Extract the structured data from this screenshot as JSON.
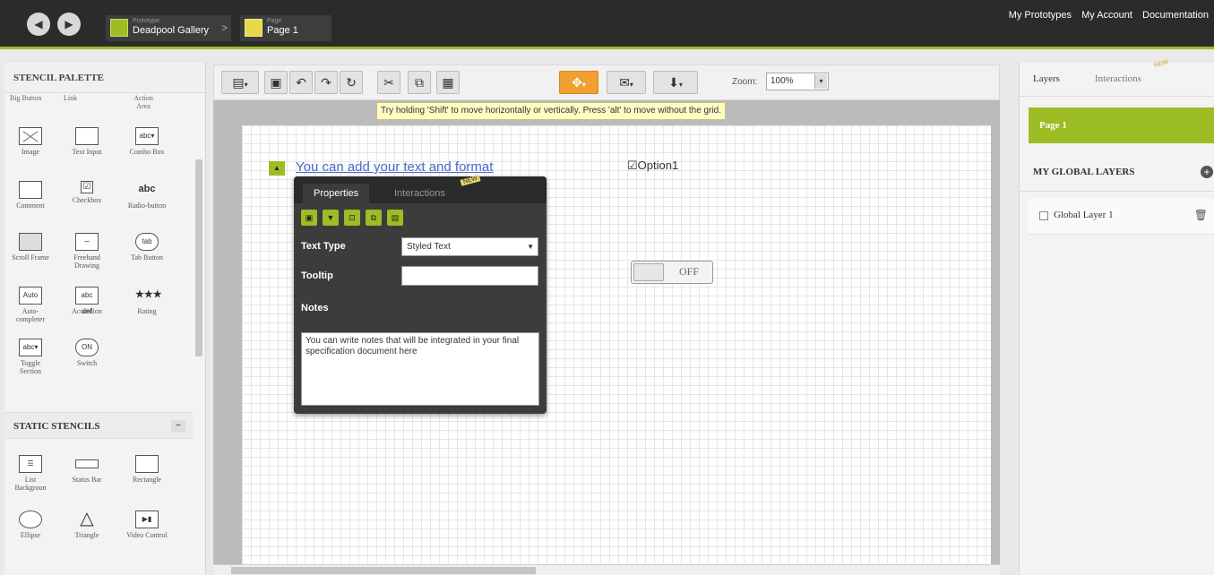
{
  "topbar": {
    "prototype_caption": "Prototype",
    "prototype_name": "Deadpool Gallery",
    "page_caption": "Page",
    "page_name": "Page 1",
    "links": [
      "My Prototypes",
      "My Account",
      "Documentation"
    ]
  },
  "palette": {
    "title": "STENCIL PALETTE",
    "top_labels": [
      "Big Button",
      "Link",
      "Action Area"
    ],
    "items": [
      {
        "label": "Image",
        "icon": "image-icon"
      },
      {
        "label": "Text Input",
        "icon": "text-input-icon"
      },
      {
        "label": "Combo Box",
        "icon": "combo-box-icon",
        "glyph": "abc▾"
      },
      {
        "label": "Comment",
        "icon": "comment-icon"
      },
      {
        "label": "Checkbox",
        "icon": "checkbox-icon",
        "glyph": "☑"
      },
      {
        "label": "Radio-button",
        "icon": "radio-button-icon",
        "glyph": "abc"
      },
      {
        "label": "Scroll Frame",
        "icon": "scroll-frame-icon"
      },
      {
        "label": "Freehand Drawing",
        "icon": "freehand-drawing-icon"
      },
      {
        "label": "Tab Button",
        "icon": "tab-button-icon",
        "glyph": "tab"
      },
      {
        "label": "Auto-completer",
        "icon": "auto-completer-icon",
        "glyph": "Auto"
      },
      {
        "label": "Accordion",
        "icon": "accordion-icon",
        "glyph": "abc def"
      },
      {
        "label": "Rating",
        "icon": "rating-icon",
        "glyph": "★★★"
      },
      {
        "label": "Toggle Section",
        "icon": "toggle-section-icon",
        "glyph": "abc▾"
      },
      {
        "label": "Switch",
        "icon": "switch-icon",
        "glyph": "ON"
      }
    ],
    "static_title": "STATIC STENCILS",
    "static_items": [
      {
        "label": "List Backgroun",
        "icon": "list-background-icon"
      },
      {
        "label": "Status Bar",
        "icon": "status-bar-icon"
      },
      {
        "label": "Rectangle",
        "icon": "rectangle-icon"
      },
      {
        "label": "Ellipse",
        "icon": "ellipse-icon"
      },
      {
        "label": "Triangle",
        "icon": "triangle-icon"
      },
      {
        "label": "Video Control",
        "icon": "video-control-icon"
      }
    ]
  },
  "toolbar": {
    "zoom_label": "Zoom:",
    "zoom_value": "100%"
  },
  "tooltip": "Try holding 'Shift' to move horizontally or vertically. Press 'alt' to move without the grid.",
  "canvas": {
    "text_widget": "You can add your text and format",
    "checkbox_label": "☑Option1",
    "switch_label": "OFF"
  },
  "properties": {
    "tab_properties": "Properties",
    "tab_interactions": "Interactions",
    "new_badge": "NEW",
    "text_type_label": "Text Type",
    "text_type_value": "Styled Text",
    "tooltip_label": "Tooltip",
    "tooltip_value": "",
    "notes_label": "Notes",
    "notes_value": "You can write notes that will be integrated in your final specification document here"
  },
  "right": {
    "tab_layers": "Layers",
    "tab_interactions": "Interactions",
    "new_badge": "NEW",
    "page_name": "Page 1",
    "global_layers_title": "MY GLOBAL LAYERS",
    "layers": [
      "Global Layer 1"
    ]
  },
  "colors": {
    "accent": "#9cbd23",
    "topbar": "#2b2b2b",
    "link": "#4a68c8"
  }
}
